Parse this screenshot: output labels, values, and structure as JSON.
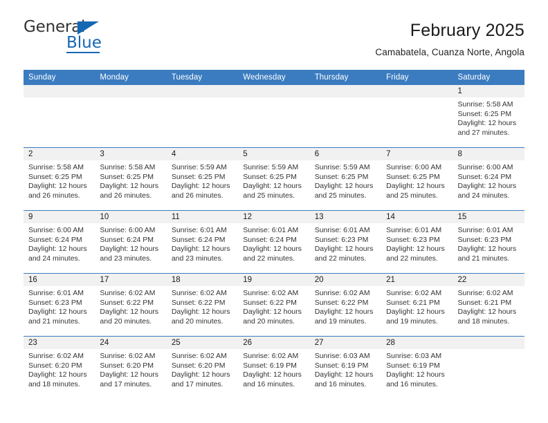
{
  "brand": {
    "line1": "General",
    "line2": "Blue",
    "triangle_icon": "triangle-icon",
    "accent_color": "#1567b3"
  },
  "header": {
    "title": "February 2025",
    "location": "Camabatela, Cuanza Norte, Angola"
  },
  "theme": {
    "header_row_bg": "#3b7cc0",
    "daynum_bg": "#f1f1f1",
    "row_divider": "#3b7cc0",
    "text": "#333333"
  },
  "weekdays": [
    "Sunday",
    "Monday",
    "Tuesday",
    "Wednesday",
    "Thursday",
    "Friday",
    "Saturday"
  ],
  "weeks": [
    [
      {
        "day": "",
        "sunrise": "",
        "sunset": "",
        "daylight": "",
        "empty": true
      },
      {
        "day": "",
        "sunrise": "",
        "sunset": "",
        "daylight": "",
        "empty": true
      },
      {
        "day": "",
        "sunrise": "",
        "sunset": "",
        "daylight": "",
        "empty": true
      },
      {
        "day": "",
        "sunrise": "",
        "sunset": "",
        "daylight": "",
        "empty": true
      },
      {
        "day": "",
        "sunrise": "",
        "sunset": "",
        "daylight": "",
        "empty": true
      },
      {
        "day": "",
        "sunrise": "",
        "sunset": "",
        "daylight": "",
        "empty": true
      },
      {
        "day": "1",
        "sunrise": "Sunrise: 5:58 AM",
        "sunset": "Sunset: 6:25 PM",
        "daylight": "Daylight: 12 hours and 27 minutes.",
        "empty": false
      }
    ],
    [
      {
        "day": "2",
        "sunrise": "Sunrise: 5:58 AM",
        "sunset": "Sunset: 6:25 PM",
        "daylight": "Daylight: 12 hours and 26 minutes.",
        "empty": false
      },
      {
        "day": "3",
        "sunrise": "Sunrise: 5:58 AM",
        "sunset": "Sunset: 6:25 PM",
        "daylight": "Daylight: 12 hours and 26 minutes.",
        "empty": false
      },
      {
        "day": "4",
        "sunrise": "Sunrise: 5:59 AM",
        "sunset": "Sunset: 6:25 PM",
        "daylight": "Daylight: 12 hours and 26 minutes.",
        "empty": false
      },
      {
        "day": "5",
        "sunrise": "Sunrise: 5:59 AM",
        "sunset": "Sunset: 6:25 PM",
        "daylight": "Daylight: 12 hours and 25 minutes.",
        "empty": false
      },
      {
        "day": "6",
        "sunrise": "Sunrise: 5:59 AM",
        "sunset": "Sunset: 6:25 PM",
        "daylight": "Daylight: 12 hours and 25 minutes.",
        "empty": false
      },
      {
        "day": "7",
        "sunrise": "Sunrise: 6:00 AM",
        "sunset": "Sunset: 6:25 PM",
        "daylight": "Daylight: 12 hours and 25 minutes.",
        "empty": false
      },
      {
        "day": "8",
        "sunrise": "Sunrise: 6:00 AM",
        "sunset": "Sunset: 6:24 PM",
        "daylight": "Daylight: 12 hours and 24 minutes.",
        "empty": false
      }
    ],
    [
      {
        "day": "9",
        "sunrise": "Sunrise: 6:00 AM",
        "sunset": "Sunset: 6:24 PM",
        "daylight": "Daylight: 12 hours and 24 minutes.",
        "empty": false
      },
      {
        "day": "10",
        "sunrise": "Sunrise: 6:00 AM",
        "sunset": "Sunset: 6:24 PM",
        "daylight": "Daylight: 12 hours and 23 minutes.",
        "empty": false
      },
      {
        "day": "11",
        "sunrise": "Sunrise: 6:01 AM",
        "sunset": "Sunset: 6:24 PM",
        "daylight": "Daylight: 12 hours and 23 minutes.",
        "empty": false
      },
      {
        "day": "12",
        "sunrise": "Sunrise: 6:01 AM",
        "sunset": "Sunset: 6:24 PM",
        "daylight": "Daylight: 12 hours and 22 minutes.",
        "empty": false
      },
      {
        "day": "13",
        "sunrise": "Sunrise: 6:01 AM",
        "sunset": "Sunset: 6:23 PM",
        "daylight": "Daylight: 12 hours and 22 minutes.",
        "empty": false
      },
      {
        "day": "14",
        "sunrise": "Sunrise: 6:01 AM",
        "sunset": "Sunset: 6:23 PM",
        "daylight": "Daylight: 12 hours and 22 minutes.",
        "empty": false
      },
      {
        "day": "15",
        "sunrise": "Sunrise: 6:01 AM",
        "sunset": "Sunset: 6:23 PM",
        "daylight": "Daylight: 12 hours and 21 minutes.",
        "empty": false
      }
    ],
    [
      {
        "day": "16",
        "sunrise": "Sunrise: 6:01 AM",
        "sunset": "Sunset: 6:23 PM",
        "daylight": "Daylight: 12 hours and 21 minutes.",
        "empty": false
      },
      {
        "day": "17",
        "sunrise": "Sunrise: 6:02 AM",
        "sunset": "Sunset: 6:22 PM",
        "daylight": "Daylight: 12 hours and 20 minutes.",
        "empty": false
      },
      {
        "day": "18",
        "sunrise": "Sunrise: 6:02 AM",
        "sunset": "Sunset: 6:22 PM",
        "daylight": "Daylight: 12 hours and 20 minutes.",
        "empty": false
      },
      {
        "day": "19",
        "sunrise": "Sunrise: 6:02 AM",
        "sunset": "Sunset: 6:22 PM",
        "daylight": "Daylight: 12 hours and 20 minutes.",
        "empty": false
      },
      {
        "day": "20",
        "sunrise": "Sunrise: 6:02 AM",
        "sunset": "Sunset: 6:22 PM",
        "daylight": "Daylight: 12 hours and 19 minutes.",
        "empty": false
      },
      {
        "day": "21",
        "sunrise": "Sunrise: 6:02 AM",
        "sunset": "Sunset: 6:21 PM",
        "daylight": "Daylight: 12 hours and 19 minutes.",
        "empty": false
      },
      {
        "day": "22",
        "sunrise": "Sunrise: 6:02 AM",
        "sunset": "Sunset: 6:21 PM",
        "daylight": "Daylight: 12 hours and 18 minutes.",
        "empty": false
      }
    ],
    [
      {
        "day": "23",
        "sunrise": "Sunrise: 6:02 AM",
        "sunset": "Sunset: 6:20 PM",
        "daylight": "Daylight: 12 hours and 18 minutes.",
        "empty": false
      },
      {
        "day": "24",
        "sunrise": "Sunrise: 6:02 AM",
        "sunset": "Sunset: 6:20 PM",
        "daylight": "Daylight: 12 hours and 17 minutes.",
        "empty": false
      },
      {
        "day": "25",
        "sunrise": "Sunrise: 6:02 AM",
        "sunset": "Sunset: 6:20 PM",
        "daylight": "Daylight: 12 hours and 17 minutes.",
        "empty": false
      },
      {
        "day": "26",
        "sunrise": "Sunrise: 6:02 AM",
        "sunset": "Sunset: 6:19 PM",
        "daylight": "Daylight: 12 hours and 16 minutes.",
        "empty": false
      },
      {
        "day": "27",
        "sunrise": "Sunrise: 6:03 AM",
        "sunset": "Sunset: 6:19 PM",
        "daylight": "Daylight: 12 hours and 16 minutes.",
        "empty": false
      },
      {
        "day": "28",
        "sunrise": "Sunrise: 6:03 AM",
        "sunset": "Sunset: 6:19 PM",
        "daylight": "Daylight: 12 hours and 16 minutes.",
        "empty": false
      },
      {
        "day": "",
        "sunrise": "",
        "sunset": "",
        "daylight": "",
        "empty": true
      }
    ]
  ]
}
